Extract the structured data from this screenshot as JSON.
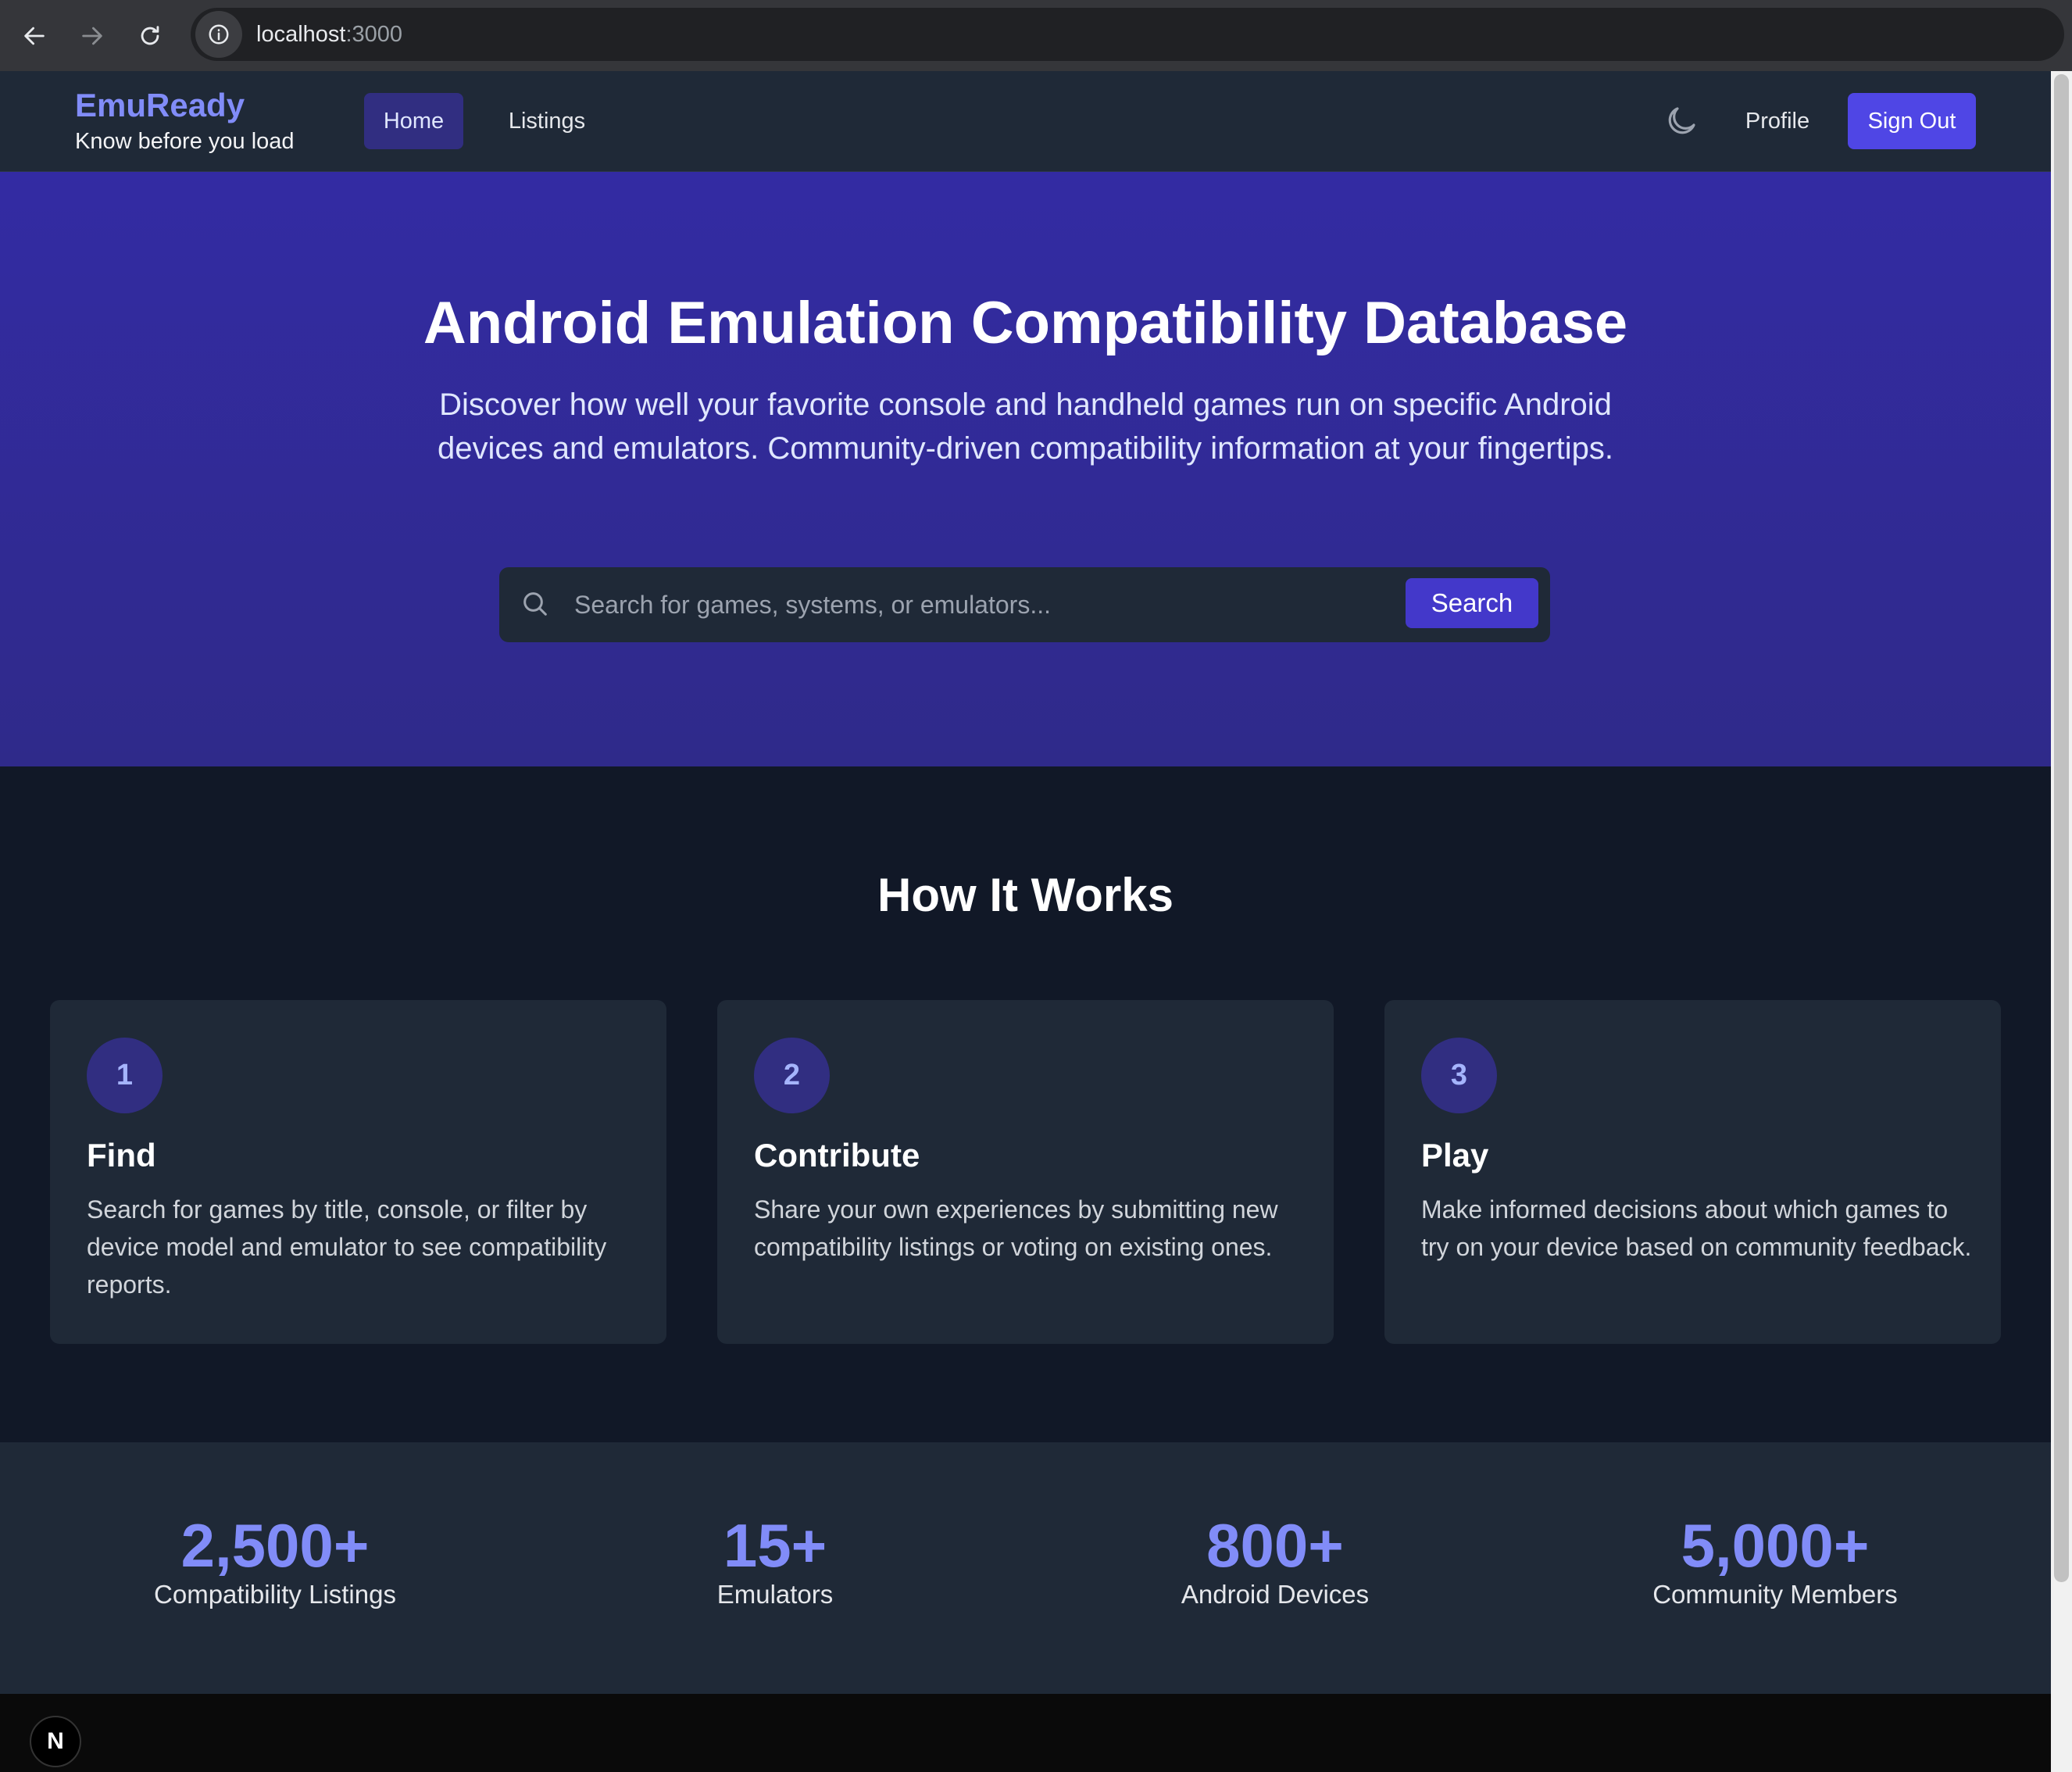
{
  "browser": {
    "url_host": "localhost",
    "url_port": ":3000"
  },
  "header": {
    "brand": "EmuReady",
    "tagline": "Know before you load",
    "nav": {
      "home": "Home",
      "listings": "Listings"
    },
    "profile": "Profile",
    "sign_out": "Sign Out",
    "theme_icon": "moon-icon"
  },
  "hero": {
    "title": "Android Emulation Compatibility Database",
    "subtitle": "Discover how well your favorite console and handheld games run on specific Android devices and emulators. Community-driven compatibility information at your fingertips.",
    "search_placeholder": "Search for games, systems, or emulators...",
    "search_button": "Search"
  },
  "how": {
    "title": "How It Works",
    "steps": [
      {
        "num": "1",
        "title": "Find",
        "desc": "Search for games by title, console, or filter by device model and emulator to see compatibility reports."
      },
      {
        "num": "2",
        "title": "Contribute",
        "desc": "Share your own experiences by submitting new compatibility listings or voting on existing ones."
      },
      {
        "num": "3",
        "title": "Play",
        "desc": "Make informed decisions about which games to try on your device based on community feedback."
      }
    ]
  },
  "stats": [
    {
      "value": "2,500+",
      "label": "Compatibility Listings"
    },
    {
      "value": "15+",
      "label": "Emulators"
    },
    {
      "value": "800+",
      "label": "Android Devices"
    },
    {
      "value": "5,000+",
      "label": "Community Members"
    }
  ],
  "dev_badge": "N",
  "colors": {
    "accent": "#4f46e5",
    "brand": "#818cf8",
    "hero_bg": "#332ba3",
    "page_bg": "#111827",
    "card_bg": "#1f2937"
  }
}
